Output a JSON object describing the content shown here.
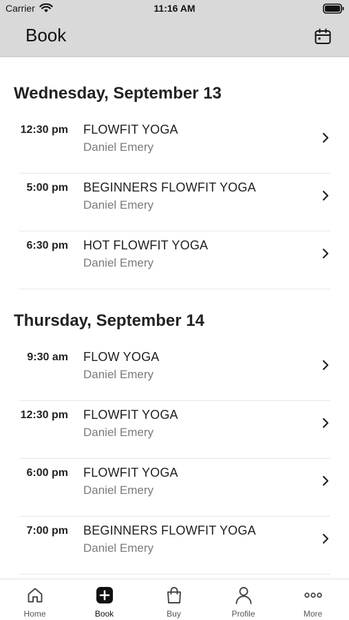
{
  "status_bar": {
    "carrier": "Carrier",
    "time": "11:16 AM"
  },
  "header": {
    "title": "Book",
    "calendar_icon": "calendar-icon"
  },
  "days": [
    {
      "title": "Wednesday, September 13",
      "classes": [
        {
          "time": "12:30 pm",
          "name": "FLOWFIT YOGA",
          "instructor": "Daniel Emery"
        },
        {
          "time": "5:00 pm",
          "name": "BEGINNERS FLOWFIT YOGA",
          "instructor": "Daniel Emery"
        },
        {
          "time": "6:30 pm",
          "name": "HOT FLOWFIT YOGA",
          "instructor": "Daniel Emery"
        }
      ]
    },
    {
      "title": "Thursday, September 14",
      "classes": [
        {
          "time": "9:30 am",
          "name": "FLOW YOGA",
          "instructor": "Daniel Emery"
        },
        {
          "time": "12:30 pm",
          "name": "FLOWFIT YOGA",
          "instructor": "Daniel Emery"
        },
        {
          "time": "6:00 pm",
          "name": "FLOWFIT YOGA",
          "instructor": "Daniel Emery"
        },
        {
          "time": "7:00 pm",
          "name": "BEGINNERS FLOWFIT YOGA",
          "instructor": "Daniel Emery"
        }
      ]
    }
  ],
  "tab_bar": {
    "tabs": [
      {
        "label": "Home",
        "icon": "home-icon"
      },
      {
        "label": "Book",
        "icon": "plus-square-icon",
        "active": true
      },
      {
        "label": "Buy",
        "icon": "shopping-bag-icon"
      },
      {
        "label": "Profile",
        "icon": "person-icon"
      },
      {
        "label": "More",
        "icon": "more-dots-icon"
      }
    ]
  },
  "colors": {
    "nav_background": "#d9d9d9",
    "active_tab": "#111111",
    "secondary_text": "#7a7a7a"
  }
}
